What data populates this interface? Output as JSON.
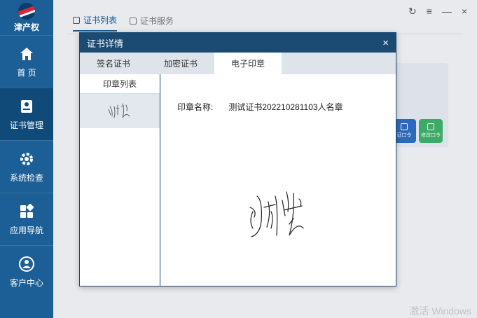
{
  "sidebar": {
    "brand": "津产权",
    "items": [
      {
        "label": "首 页",
        "icon": "home-icon"
      },
      {
        "label": "证书管理",
        "icon": "certificate-icon"
      },
      {
        "label": "系统检查",
        "icon": "gear-icon"
      },
      {
        "label": "应用导航",
        "icon": "apps-grid-icon"
      },
      {
        "label": "客户中心",
        "icon": "customer-icon"
      }
    ],
    "active_index": 1
  },
  "main": {
    "tabs": [
      {
        "label": "证书列表",
        "icon": "list-icon"
      },
      {
        "label": "证书服务",
        "icon": "service-icon"
      }
    ],
    "bg_buttons": [
      {
        "label": "证口令"
      },
      {
        "label": "修改口令"
      }
    ]
  },
  "dialog": {
    "title": "证书详情",
    "close": "×",
    "tabs": [
      "签名证书",
      "加密证书",
      "电子印章"
    ],
    "active_tab": 2,
    "seal_list_header": "印章列表",
    "seal_name_label": "印章名称:",
    "seal_name_value": "测试证书202210281103人名章",
    "signature_icon": "handwritten-signature"
  },
  "window_controls": [
    "↻",
    "≡",
    "—",
    "×"
  ],
  "watermark": "激活 Windows",
  "colors": {
    "sidebar": "#1c5f96",
    "sidebar_active": "#0f4a78",
    "dialog_header": "#1b4a73",
    "accent_blue": "#2f6fc4",
    "accent_green": "#3db36b"
  }
}
